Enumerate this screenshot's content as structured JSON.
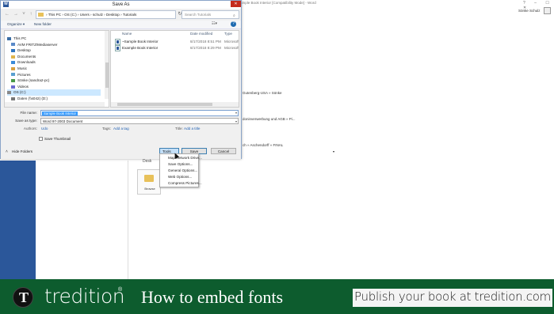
{
  "word": {
    "title": "Sample Book Interior [Compatibility Mode] - Word",
    "user": "Sönke Schulz",
    "window_controls": "? – ☐ ✕",
    "bg_lines": [
      "Gutenberg-USA » Sönke",
      "doninverwerbung und AGB » Pi...",
      "ch » Aschendorff » FINAL"
    ],
    "desktop_label": "Desk",
    "browse_label": "Browse"
  },
  "dialog": {
    "title": "Save As",
    "address_path": "›  This PC  ›  OS (C:)  ›  Users  ›  schulz  ›  Desktop  ›  Tutorials",
    "search_placeholder": "Search Tutorials",
    "organize": "Organize ▾",
    "new_folder": "New folder",
    "nav_items": [
      {
        "label": "This PC",
        "color": "#3a6ea5"
      },
      {
        "label": "AVM FRITZ!Mediaserver",
        "color": "#5a8ac8"
      },
      {
        "label": "Desktop",
        "color": "#2f76c0"
      },
      {
        "label": "Documents",
        "color": "#e0b44a"
      },
      {
        "label": "Downloads",
        "color": "#3a8ad8"
      },
      {
        "label": "Music",
        "color": "#d8a040"
      },
      {
        "label": "Pictures",
        "color": "#5aa0d0"
      },
      {
        "label": "Sönke (sandra2-pc)",
        "color": "#4a9a4a"
      },
      {
        "label": "Videos",
        "color": "#6a6ad0"
      },
      {
        "label": "OS (C:)",
        "color": "#888888"
      },
      {
        "label": "Daten (\\\\s042) (D:)",
        "color": "#777777"
      },
      {
        "label": "Intern (\\\\s042) (I:)",
        "color": "#777777"
      }
    ],
    "columns": {
      "name": "Name",
      "date": "Date modified",
      "type": "Type"
    },
    "files": [
      {
        "name": "~Sample Book Interior",
        "date": "8/17/2018 8:51 PM",
        "type": "Microsoft W"
      },
      {
        "name": "Example Book Interior",
        "date": "8/17/2018 8:29 PM",
        "type": "Microsoft W"
      }
    ],
    "file_name_label": "File name:",
    "file_name_value": "Sample Book Interior",
    "save_type_label": "Save as type:",
    "save_type_value": "Word 97-2003 Document",
    "authors_label": "Authors:",
    "authors_value": "Udo",
    "tags_label": "Tags:",
    "tags_value": "Add a tag",
    "title_label": "Title:",
    "title_value": "Add a title",
    "save_thumbnail": "Save Thumbnail",
    "hide_folders": "Hide Folders",
    "tools": "Tools",
    "save": "Save",
    "cancel": "Cancel"
  },
  "tools_menu": [
    "Map Network Drive...",
    "Save Options...",
    "General Options...",
    "Web Options...",
    "Compress Pictures..."
  ],
  "banner": {
    "logo_letter": "T",
    "brand": "tredition",
    "registered": "®",
    "video_title": "How to embed fonts",
    "publish": "Publish your book at tredition.com"
  }
}
